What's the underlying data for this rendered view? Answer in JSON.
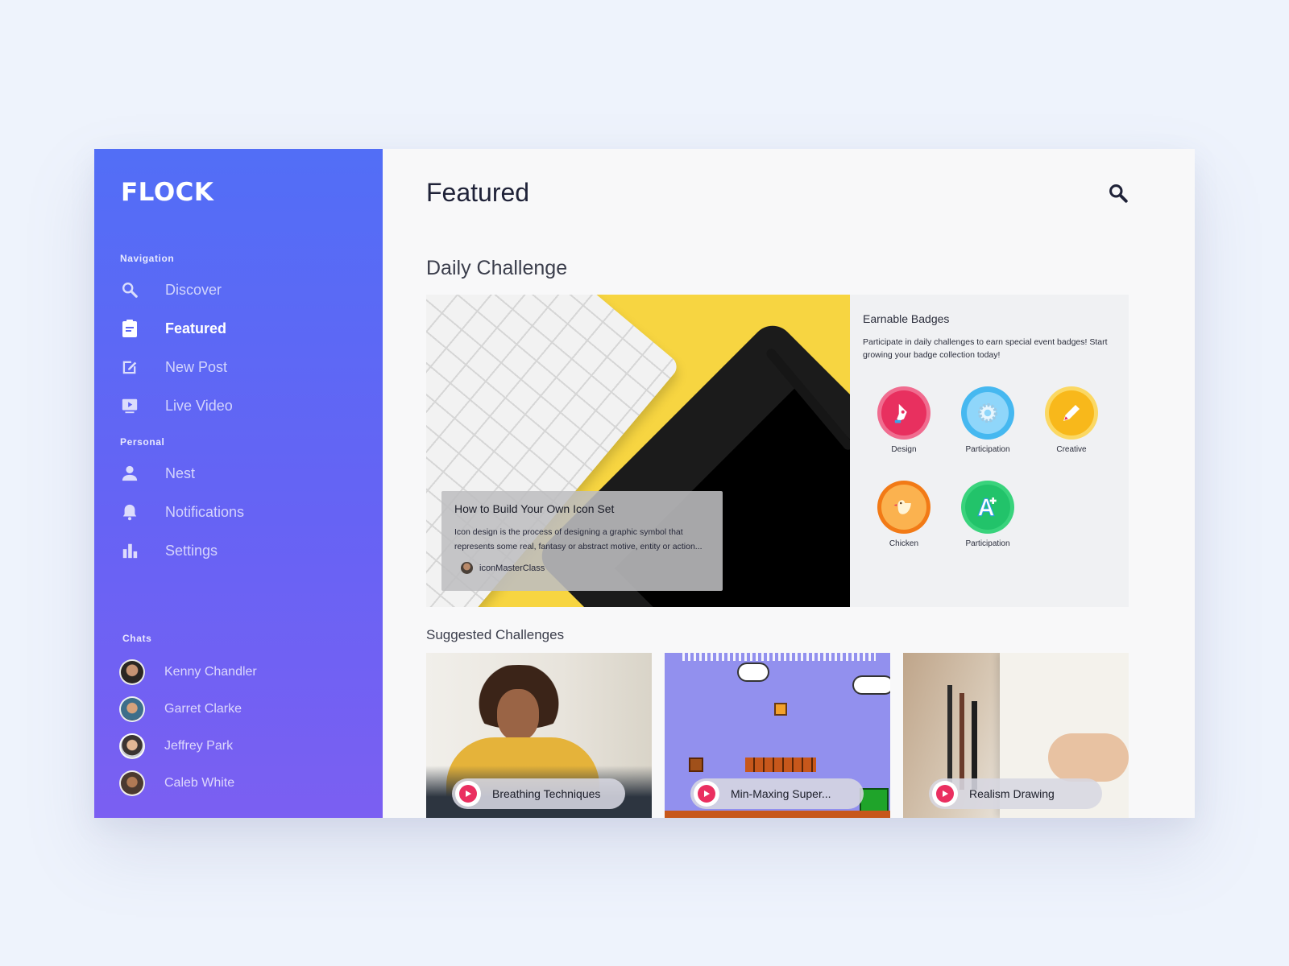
{
  "app": {
    "logo": "FLOCK",
    "brand_gradient": [
      "#526ef6",
      "#7b5ff2"
    ]
  },
  "sidebar": {
    "navigation_label": "Navigation",
    "nav_items": [
      {
        "label": "Discover",
        "icon": "search-icon",
        "active": false
      },
      {
        "label": "Featured",
        "icon": "clipboard-icon",
        "active": true
      },
      {
        "label": "New Post",
        "icon": "edit-icon",
        "active": false
      },
      {
        "label": "Live Video",
        "icon": "video-icon",
        "active": false
      }
    ],
    "personal_label": "Personal",
    "personal_items": [
      {
        "label": "Nest",
        "icon": "user-icon"
      },
      {
        "label": "Notifications",
        "icon": "bell-icon"
      },
      {
        "label": "Settings",
        "icon": "bar-chart-icon"
      }
    ],
    "chats_label": "Chats",
    "chats": [
      {
        "name": "Kenny Chandler"
      },
      {
        "name": "Garret Clarke"
      },
      {
        "name": "Jeffrey Park"
      },
      {
        "name": "Caleb White"
      }
    ]
  },
  "main": {
    "title": "Featured",
    "daily_heading": "Daily Challenge",
    "article": {
      "title": "How to Build Your Own Icon Set",
      "description": "Icon design is the process of designing a graphic symbol that represents some real, fantasy or abstract motive, entity or action...",
      "author": "iconMasterClass"
    },
    "badges": {
      "title": "Earnable Badges",
      "description": "Participate in daily challenges to earn special event badges! Start growing your badge collection today!",
      "items": [
        {
          "name": "Design",
          "icon": "pen-nib-icon",
          "color": "#e8305f"
        },
        {
          "name": "Participation",
          "icon": "gear-icon",
          "color": "#46b8f0"
        },
        {
          "name": "Creative",
          "icon": "pencil-icon",
          "color": "#f8b81b"
        },
        {
          "name": "Chicken",
          "icon": "chicken-icon",
          "color": "#f27a16"
        },
        {
          "name": "Participation",
          "icon": "a-plus-icon",
          "color": "#22c36a"
        }
      ]
    },
    "suggested_heading": "Suggested Challenges",
    "suggested": [
      {
        "label": "Breathing Techniques"
      },
      {
        "label": "Min-Maxing Super..."
      },
      {
        "label": "Realism Drawing"
      }
    ],
    "accent_play_color": "#ea2f60"
  }
}
